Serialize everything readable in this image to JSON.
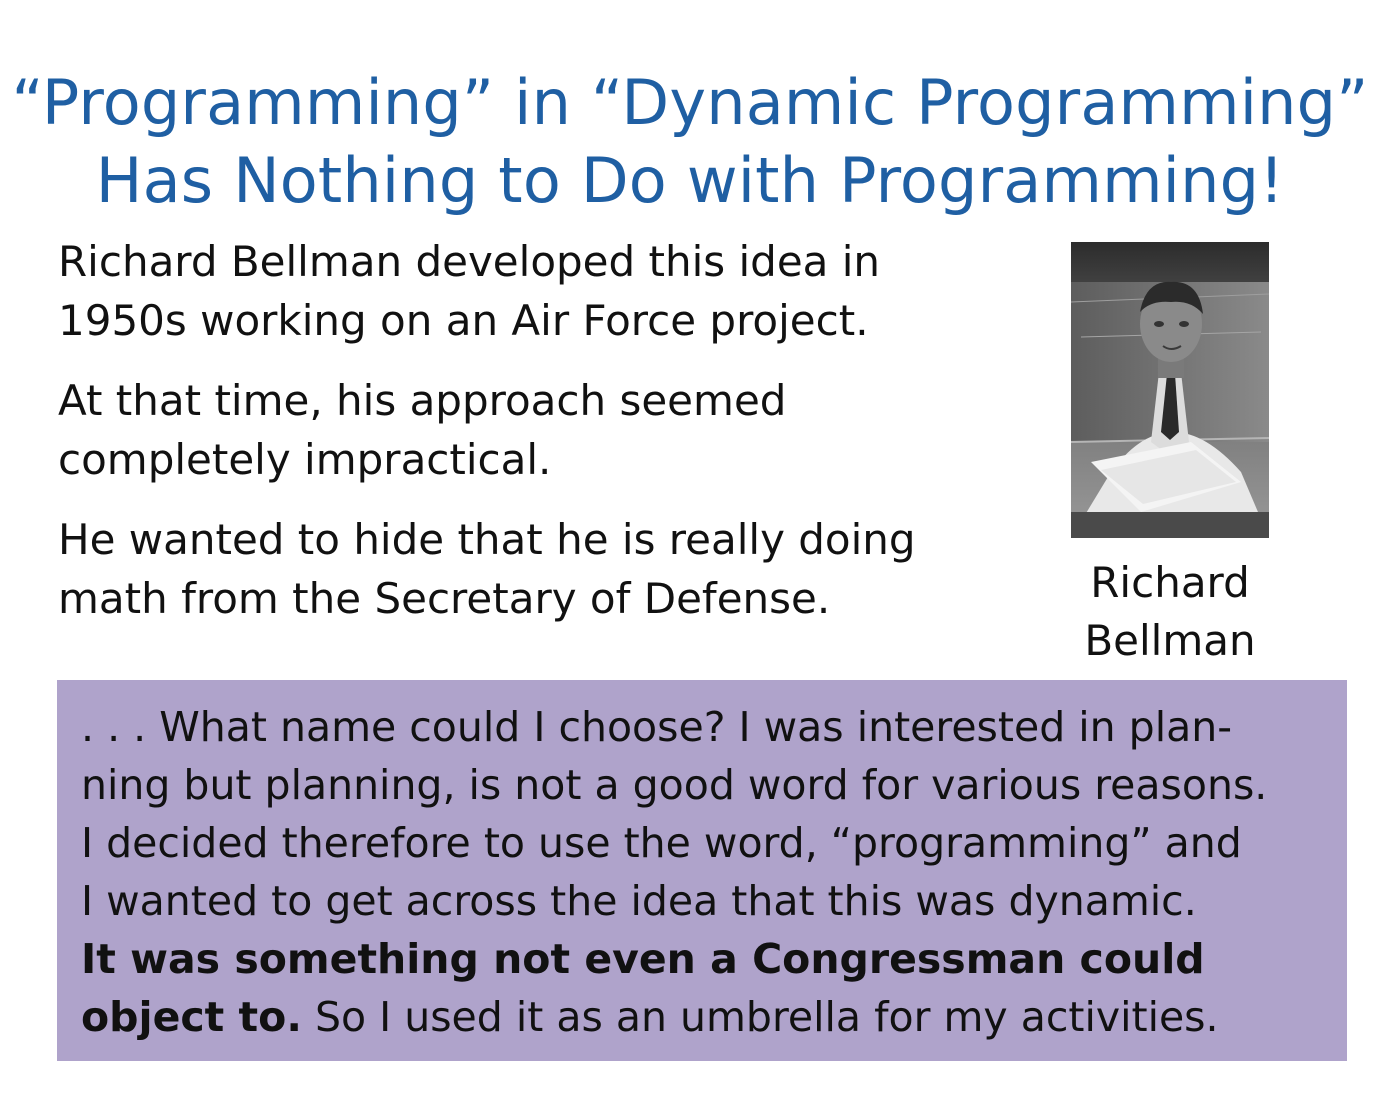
{
  "title": {
    "line1": "“Programming” in “Dynamic Programming”",
    "line2": "Has Nothing to Do with Programming!"
  },
  "paragraphs": [
    {
      "lines": [
        "Richard Bellman developed this idea in",
        "1950s working on an Air Force project."
      ]
    },
    {
      "lines": [
        "At that time, his approach seemed",
        "completely impractical."
      ]
    },
    {
      "lines": [
        "He wanted to hide that he is really doing",
        "math from the Secretary of Defense."
      ]
    }
  ],
  "photo": {
    "caption_line1": "Richard",
    "caption_line2": "Bellman"
  },
  "quote": {
    "line1": ". . . What name could I choose? I was interested in plan-",
    "line2": "ning but planning, is not a good word for various reasons.",
    "line3": "I decided therefore to use the word, “programming” and",
    "line4": "I wanted to get across the idea that this was dynamic.",
    "line5_bold": "It was something not even a Congressman could",
    "line6_bold": "object to.",
    "line6_rest": " So I used it as an umbrella for my activities."
  },
  "colors": {
    "title": "#1f5fa3",
    "quote_background": "#afa3cb"
  }
}
